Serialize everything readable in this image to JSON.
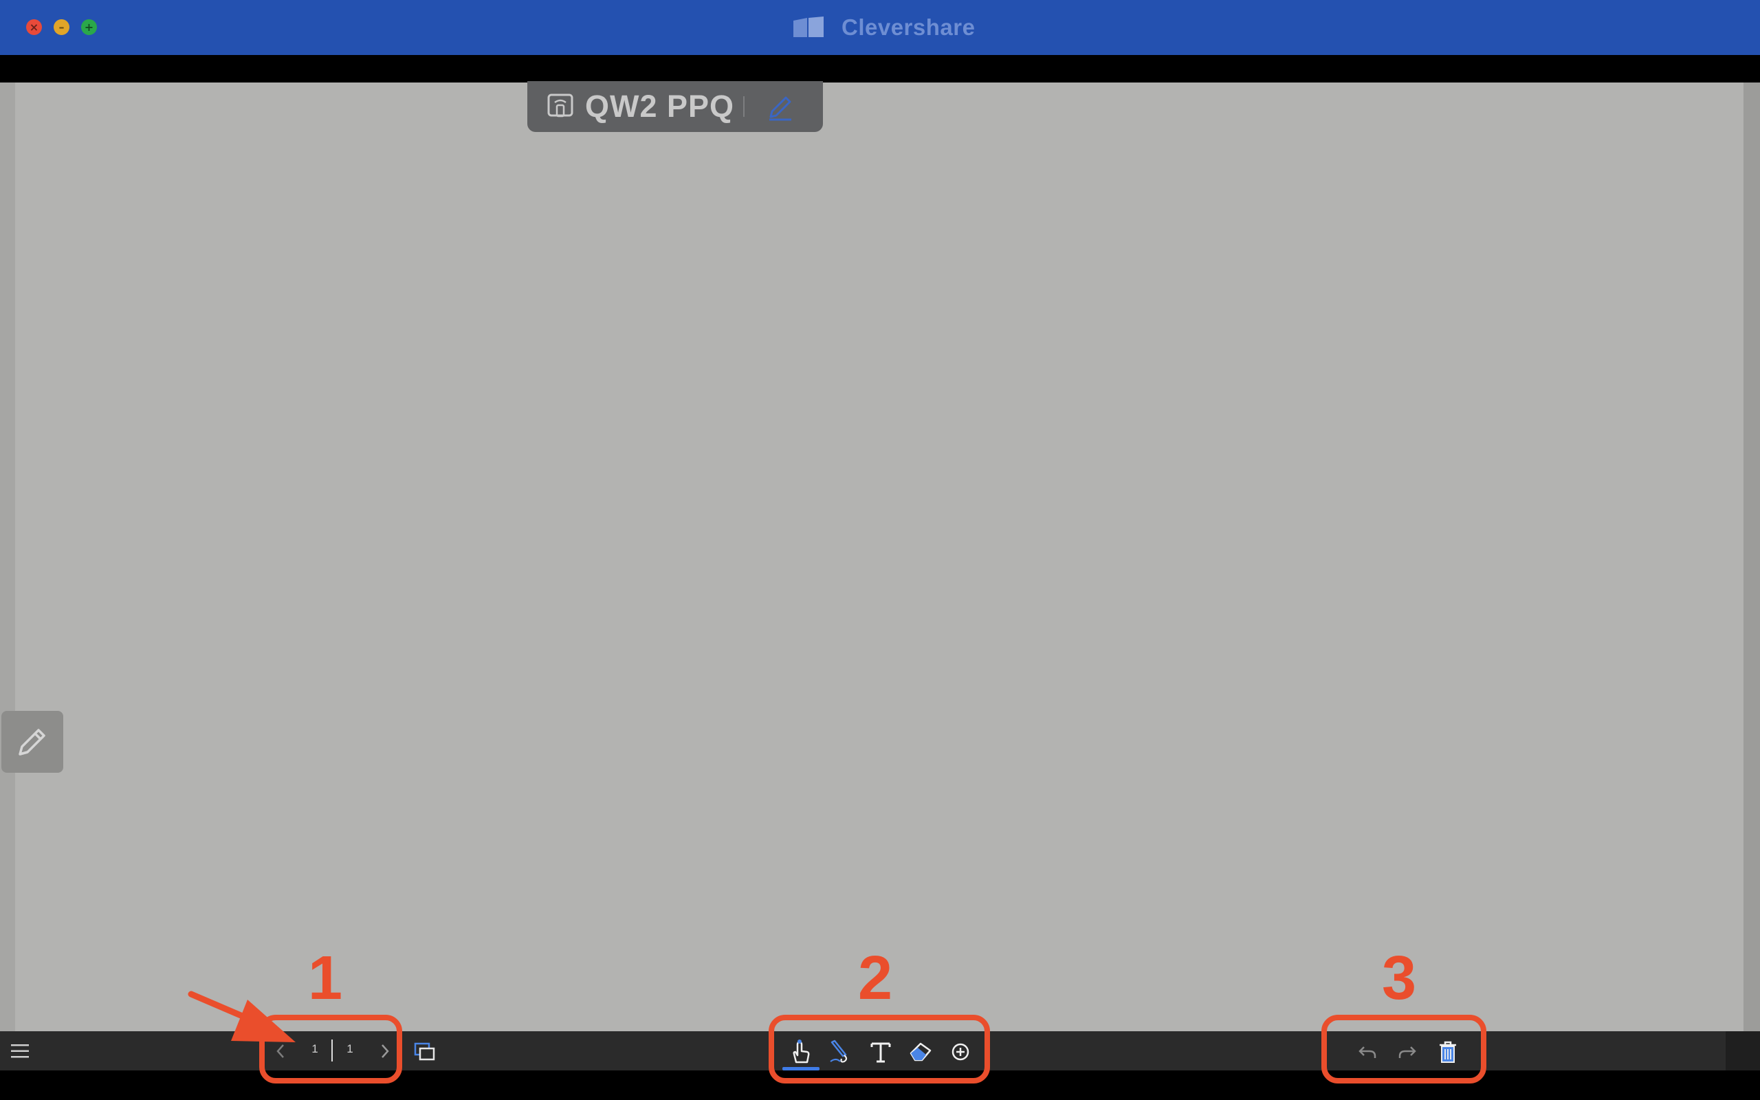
{
  "window": {
    "app_title": "Clevershare"
  },
  "connection_pill": {
    "code": "QW2 PPQ"
  },
  "pagination": {
    "current_page": "1",
    "total_pages": "1"
  },
  "annotations": {
    "callout_1": "1",
    "callout_2": "2",
    "callout_3": "3",
    "color": "#ea4e2c"
  },
  "colors": {
    "titlebar": "#2451b0",
    "accent": "#3f7be6",
    "canvas": "#b3b3b1",
    "toolbar": "#2b2b2b"
  },
  "toolbar": {
    "tools": [
      "hand-tool",
      "pen-tool",
      "text-tool",
      "eraser-tool",
      "add-tool"
    ],
    "active_tool": "hand-tool",
    "actions": [
      "undo",
      "redo",
      "clear"
    ]
  }
}
